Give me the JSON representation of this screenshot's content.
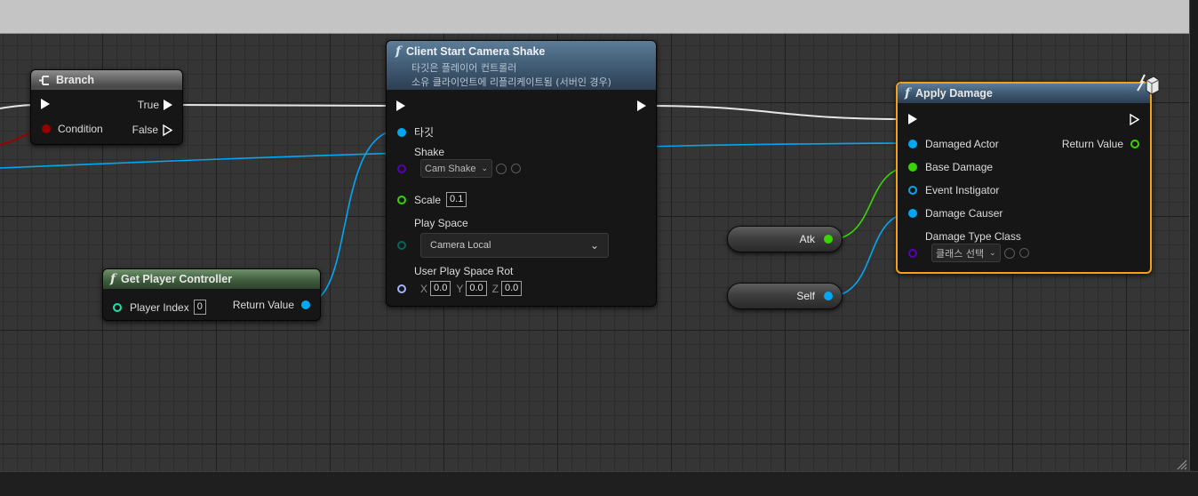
{
  "nodes": {
    "branch": {
      "title": "Branch",
      "exec_out_true": "True",
      "exec_out_false": "False",
      "condition": "Condition"
    },
    "camera_shake": {
      "title": "Client Start Camera Shake",
      "subtitle_line1": "타깃은 플레이어 컨트롤러",
      "subtitle_line2": "소유 클라이언트에 리플리케이트됨 (서버인 경우)",
      "target_label": "타깃",
      "shake_label": "Shake",
      "shake_value": "Cam Shake",
      "scale_label": "Scale",
      "scale_value": "0.1",
      "play_space_label": "Play Space",
      "play_space_value": "Camera Local",
      "rot_label": "User Play Space Rot",
      "rot_x_label": "X",
      "rot_x": "0.0",
      "rot_y_label": "Y",
      "rot_y": "0.0",
      "rot_z_label": "Z",
      "rot_z": "0.0"
    },
    "get_player_controller": {
      "title": "Get Player Controller",
      "player_index_label": "Player Index",
      "player_index_value": "0",
      "return_value": "Return Value"
    },
    "apply_damage": {
      "title": "Apply Damage",
      "damaged_actor": "Damaged Actor",
      "return_value": "Return Value",
      "base_damage": "Base Damage",
      "event_instigator": "Event Instigator",
      "damage_causer": "Damage Causer",
      "damage_type_class": "Damage Type Class",
      "damage_type_value": "클래스 선택"
    },
    "atk": {
      "label": "Atk"
    },
    "self": {
      "label": "Self"
    }
  },
  "colors": {
    "exec": "#ffffff",
    "bool": "#9b0000",
    "object": "#00a8f4",
    "float": "#38d500",
    "class": "#5a00b4",
    "int": "#1fe1a8",
    "enum": "#00655e",
    "rotator": "#a0b4ff",
    "selected_outline": "#f2a21a"
  }
}
